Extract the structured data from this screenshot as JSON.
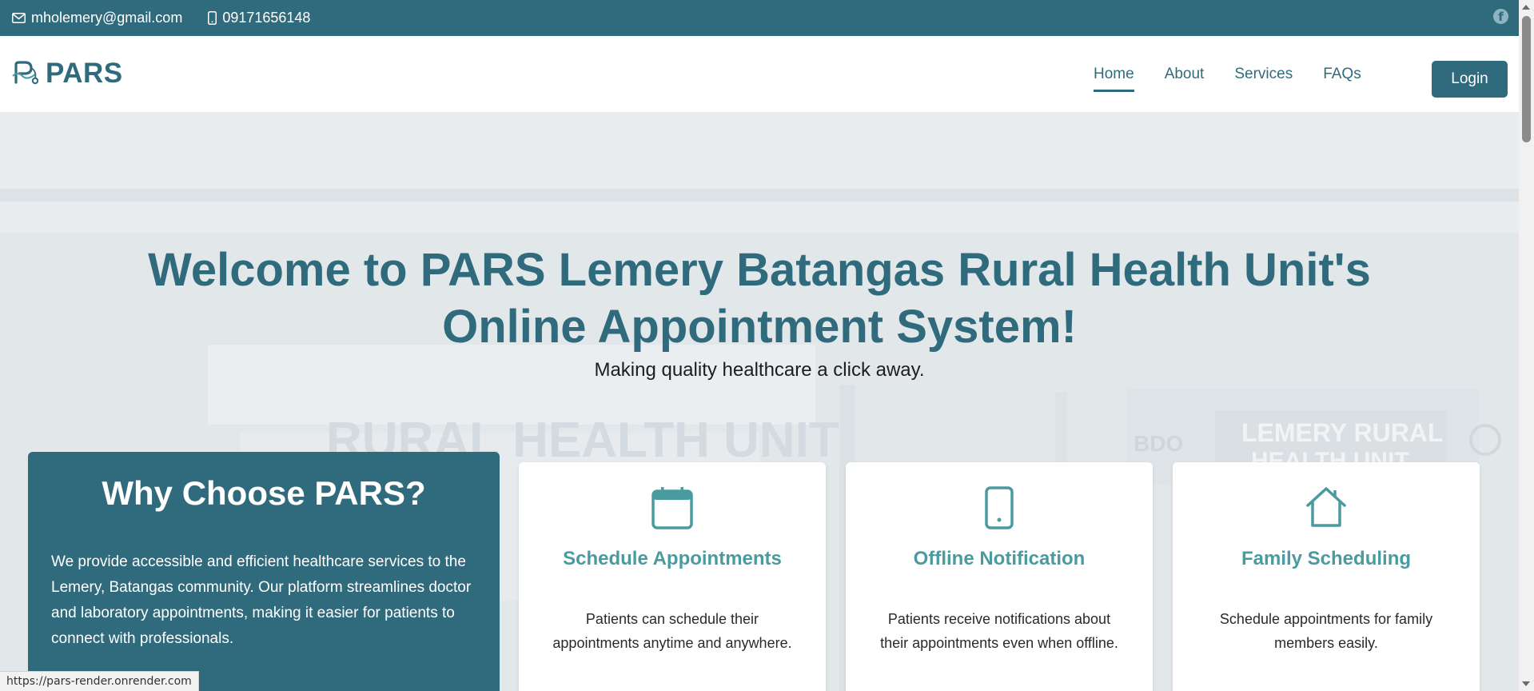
{
  "topbar": {
    "email": "mholemery@gmail.com",
    "phone": "09171656148",
    "social_icon": "facebook-icon"
  },
  "brand": {
    "name": "PARS",
    "logo_icon": "pars-logo-icon"
  },
  "nav": {
    "items": [
      {
        "label": "Home",
        "active": true
      },
      {
        "label": "About",
        "active": false
      },
      {
        "label": "Services",
        "active": false
      },
      {
        "label": "FAQs",
        "active": false
      }
    ],
    "login_label": "Login"
  },
  "hero": {
    "title_line1": "Welcome to PARS Lemery Batangas Rural Health Unit's",
    "title_line2": "Online Appointment System!",
    "subtitle": "Making quality healthcare a click away.",
    "bg_sign_left": "RURAL HEALTH UNIT",
    "bg_sign_right_line1": "LEMERY RURAL",
    "bg_sign_right_line2": "HEALTH UNIT",
    "bg_bdo": "BDO"
  },
  "why": {
    "title": "Why Choose PARS?",
    "text": "We provide accessible and efficient healthcare services to the Lemery, Batangas community. Our platform streamlines doctor and laboratory appointments, making it easier for patients to connect with professionals."
  },
  "features": [
    {
      "icon": "calendar-icon",
      "title": "Schedule Appointments",
      "desc": "Patients can schedule their appointments anytime and anywhere."
    },
    {
      "icon": "mobile-phone-icon",
      "title": "Offline Notification",
      "desc": "Patients receive notifications about their appointments even when offline."
    },
    {
      "icon": "house-icon",
      "title": "Family Scheduling",
      "desc": "Schedule appointments for family members easily."
    }
  ],
  "status_bar": {
    "url": "https://pars-render.onrender.com"
  },
  "colors": {
    "primary": "#306b7d",
    "accent_teal": "#4a9ba0",
    "hero_bg": "#e8ecef"
  }
}
